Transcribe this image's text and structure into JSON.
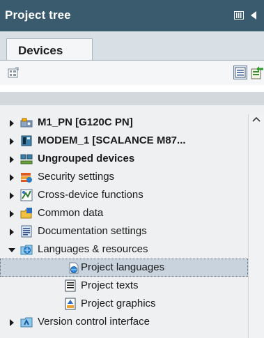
{
  "panel": {
    "title": "Project tree",
    "pin_icon": "pin-icon",
    "collapse_icon": "collapse-left-icon"
  },
  "tabs": [
    {
      "label": "Devices",
      "active": true
    }
  ],
  "toolbar": {
    "left_button_icon": "overview-icon",
    "right_buttons": [
      "details-view-icon",
      "export-icon"
    ]
  },
  "tree": {
    "items": [
      {
        "label": "M1_PN [G120C PN]",
        "bold": true,
        "expanded": false,
        "icon": "drive-device-icon"
      },
      {
        "label": "MODEM_1 [SCALANCE M87...",
        "bold": true,
        "expanded": false,
        "icon": "modem-device-icon"
      },
      {
        "label": "Ungrouped devices",
        "bold": true,
        "expanded": false,
        "icon": "ungrouped-devices-icon"
      },
      {
        "label": "Security settings",
        "bold": false,
        "expanded": false,
        "icon": "security-settings-icon"
      },
      {
        "label": "Cross-device functions",
        "bold": false,
        "expanded": false,
        "icon": "cross-device-icon"
      },
      {
        "label": "Common data",
        "bold": false,
        "expanded": false,
        "icon": "common-data-icon"
      },
      {
        "label": "Documentation settings",
        "bold": false,
        "expanded": false,
        "icon": "documentation-icon"
      },
      {
        "label": "Languages & resources",
        "bold": false,
        "expanded": true,
        "icon": "languages-icon"
      },
      {
        "label": "Project languages",
        "bold": false,
        "child": true,
        "selected": true,
        "icon": "project-languages-icon"
      },
      {
        "label": "Project texts",
        "bold": false,
        "child": true,
        "icon": "project-texts-icon"
      },
      {
        "label": "Project graphics",
        "bold": false,
        "child": true,
        "icon": "project-graphics-icon"
      },
      {
        "label": "Version control interface",
        "bold": false,
        "expanded": false,
        "icon": "version-control-icon"
      }
    ]
  },
  "colors": {
    "title_bar": "#3a5a6e",
    "selection": "#c9d3de",
    "tree_background": "#eef0f2"
  }
}
